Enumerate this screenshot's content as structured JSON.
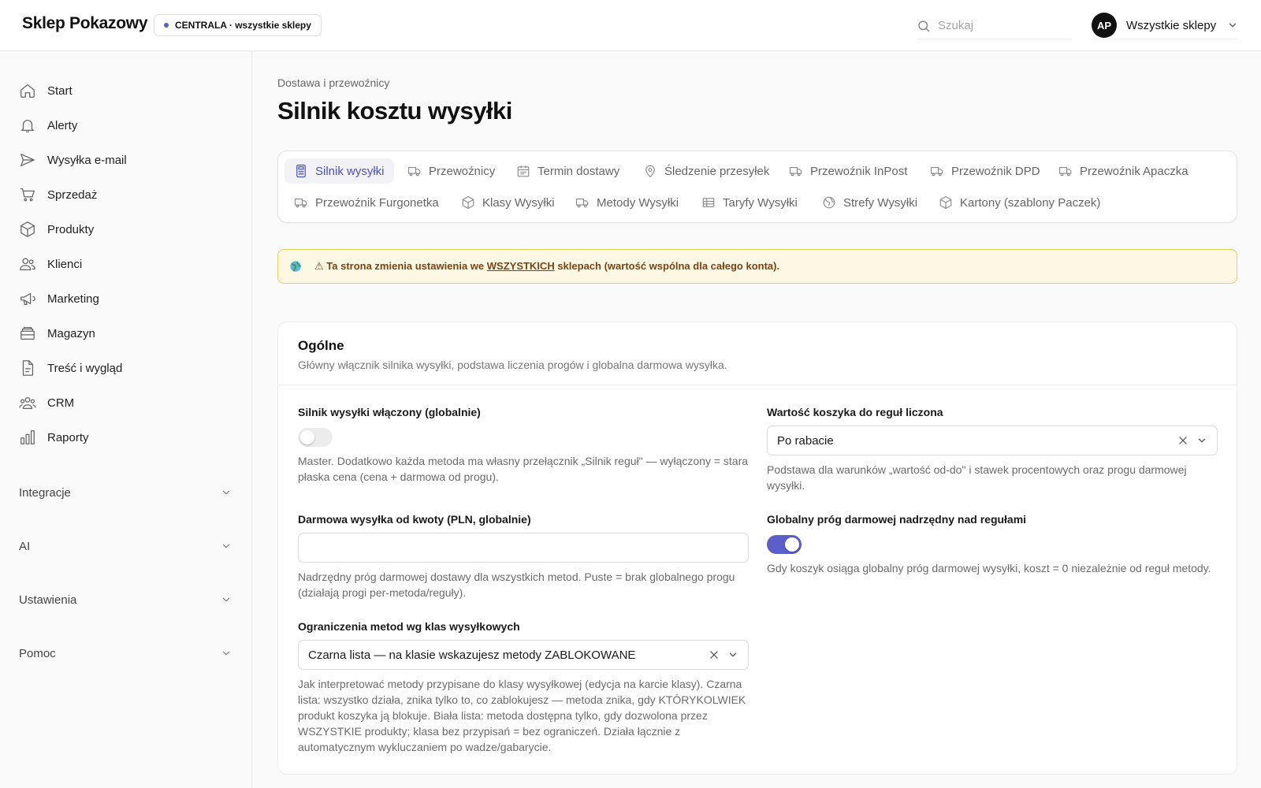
{
  "header": {
    "logo": "Sklep Pokazowy",
    "store_badge": "CENTRALA · wszystkie sklepy",
    "search_placeholder": "Szukaj",
    "user_initials": "AP",
    "user_label": "Wszystkie sklepy"
  },
  "sidebar": {
    "items": [
      {
        "label": "Start",
        "icon": "home-icon"
      },
      {
        "label": "Alerty",
        "icon": "bell-icon"
      },
      {
        "label": "Wysyłka e-mail",
        "icon": "send-icon"
      },
      {
        "label": "Sprzedaż",
        "icon": "cart-icon"
      },
      {
        "label": "Produkty",
        "icon": "box-icon"
      },
      {
        "label": "Klienci",
        "icon": "users-icon"
      },
      {
        "label": "Marketing",
        "icon": "megaphone-icon"
      },
      {
        "label": "Magazyn",
        "icon": "warehouse-icon"
      },
      {
        "label": "Treść i wygląd",
        "icon": "document-icon"
      },
      {
        "label": "CRM",
        "icon": "group-icon"
      },
      {
        "label": "Raporty",
        "icon": "bar-chart-icon"
      }
    ],
    "groups": [
      {
        "label": "Integracje"
      },
      {
        "label": "AI"
      },
      {
        "label": "Ustawienia"
      },
      {
        "label": "Pomoc"
      }
    ]
  },
  "page": {
    "breadcrumb": "Dostawa i przewoźnicy",
    "title": "Silnik kosztu wysyłki"
  },
  "tabs": [
    {
      "label": "Silnik wysyłki",
      "icon": "calculator-icon",
      "active": true
    },
    {
      "label": "Przewoźnicy",
      "icon": "truck-icon"
    },
    {
      "label": "Termin dostawy",
      "icon": "calendar-icon"
    },
    {
      "label": "Śledzenie przesyłek",
      "icon": "map-pin-icon"
    },
    {
      "label": "Przewoźnik InPost",
      "icon": "truck-icon"
    },
    {
      "label": "Przewoźnik DPD",
      "icon": "truck-icon"
    },
    {
      "label": "Przewoźnik Apaczka",
      "icon": "truck-icon"
    },
    {
      "label": "Przewoźnik Furgonetka",
      "icon": "truck-icon"
    },
    {
      "label": "Klasy Wysyłki",
      "icon": "box-icon"
    },
    {
      "label": "Metody Wysyłki",
      "icon": "truck-icon"
    },
    {
      "label": "Taryfy Wysyłki",
      "icon": "table-icon"
    },
    {
      "label": "Strefy Wysyłki",
      "icon": "globe-icon"
    },
    {
      "label": "Kartony (szablony Paczek)",
      "icon": "box-icon"
    }
  ],
  "alert": {
    "prefix": "⚠ Ta strona zmienia ustawienia we ",
    "emphasis": "WSZYSTKICH",
    "suffix": " sklepach (wartość wspólna dla całego konta).",
    "icon": "globe-emoji-icon"
  },
  "section": {
    "title": "Ogólne",
    "description": "Główny włącznik silnika wysyłki, podstawa liczenia progów i globalna darmowa wysyłka.",
    "fields": {
      "engine_enabled": {
        "label": "Silnik wysyłki włączony (globalnie)",
        "on": false,
        "help": "Master. Dodatkowo każda metoda ma własny przełącznik „Silnik reguł\" — wyłączony = stara płaska cena (cena + darmowa od progu)."
      },
      "cart_value_basis": {
        "label": "Wartość koszyka do reguł liczona",
        "value": "Po rabacie",
        "help": "Podstawa dla warunków „wartość od-do\" i stawek procentowych oraz progu darmowej wysyłki."
      },
      "free_shipping_from": {
        "label": "Darmowa wysyłka od kwoty (PLN, globalnie)",
        "value": "",
        "help": "Nadrzędny próg darmowej dostawy dla wszystkich metod. Puste = brak globalnego progu (działają progi per-metoda/reguły)."
      },
      "global_threshold_override": {
        "label": "Globalny próg darmowej nadrzędny nad regułami",
        "on": true,
        "help": "Gdy koszyk osiąga globalny próg darmowej wysyłki, koszt = 0 niezależnie od reguł metody."
      },
      "class_restrictions": {
        "label": "Ograniczenia metod wg klas wysyłkowych",
        "value": "Czarna lista — na klasie wskazujesz metody ZABLOKOWANE",
        "help": "Jak interpretować metody przypisane do klasy wysyłkowej (edycja na karcie klasy). Czarna lista: wszystko działa, znika tylko to, co zablokujesz — metoda znika, gdy KTÓRYKOLWIEK produkt koszyka ją blokuje. Biała lista: metoda dostępna tylko, gdy dozwolona przez WSZYSTKIE produkty; klasa bez przypisań = bez ograniczeń. Działa łącznie z automatycznym wykluczaniem po wadze/gabarycie."
      }
    }
  },
  "colors": {
    "accent": "#5b5fc7",
    "alert_bg": "#fdf8e4",
    "alert_border": "#ebcf5b",
    "alert_text": "#7a4312"
  }
}
